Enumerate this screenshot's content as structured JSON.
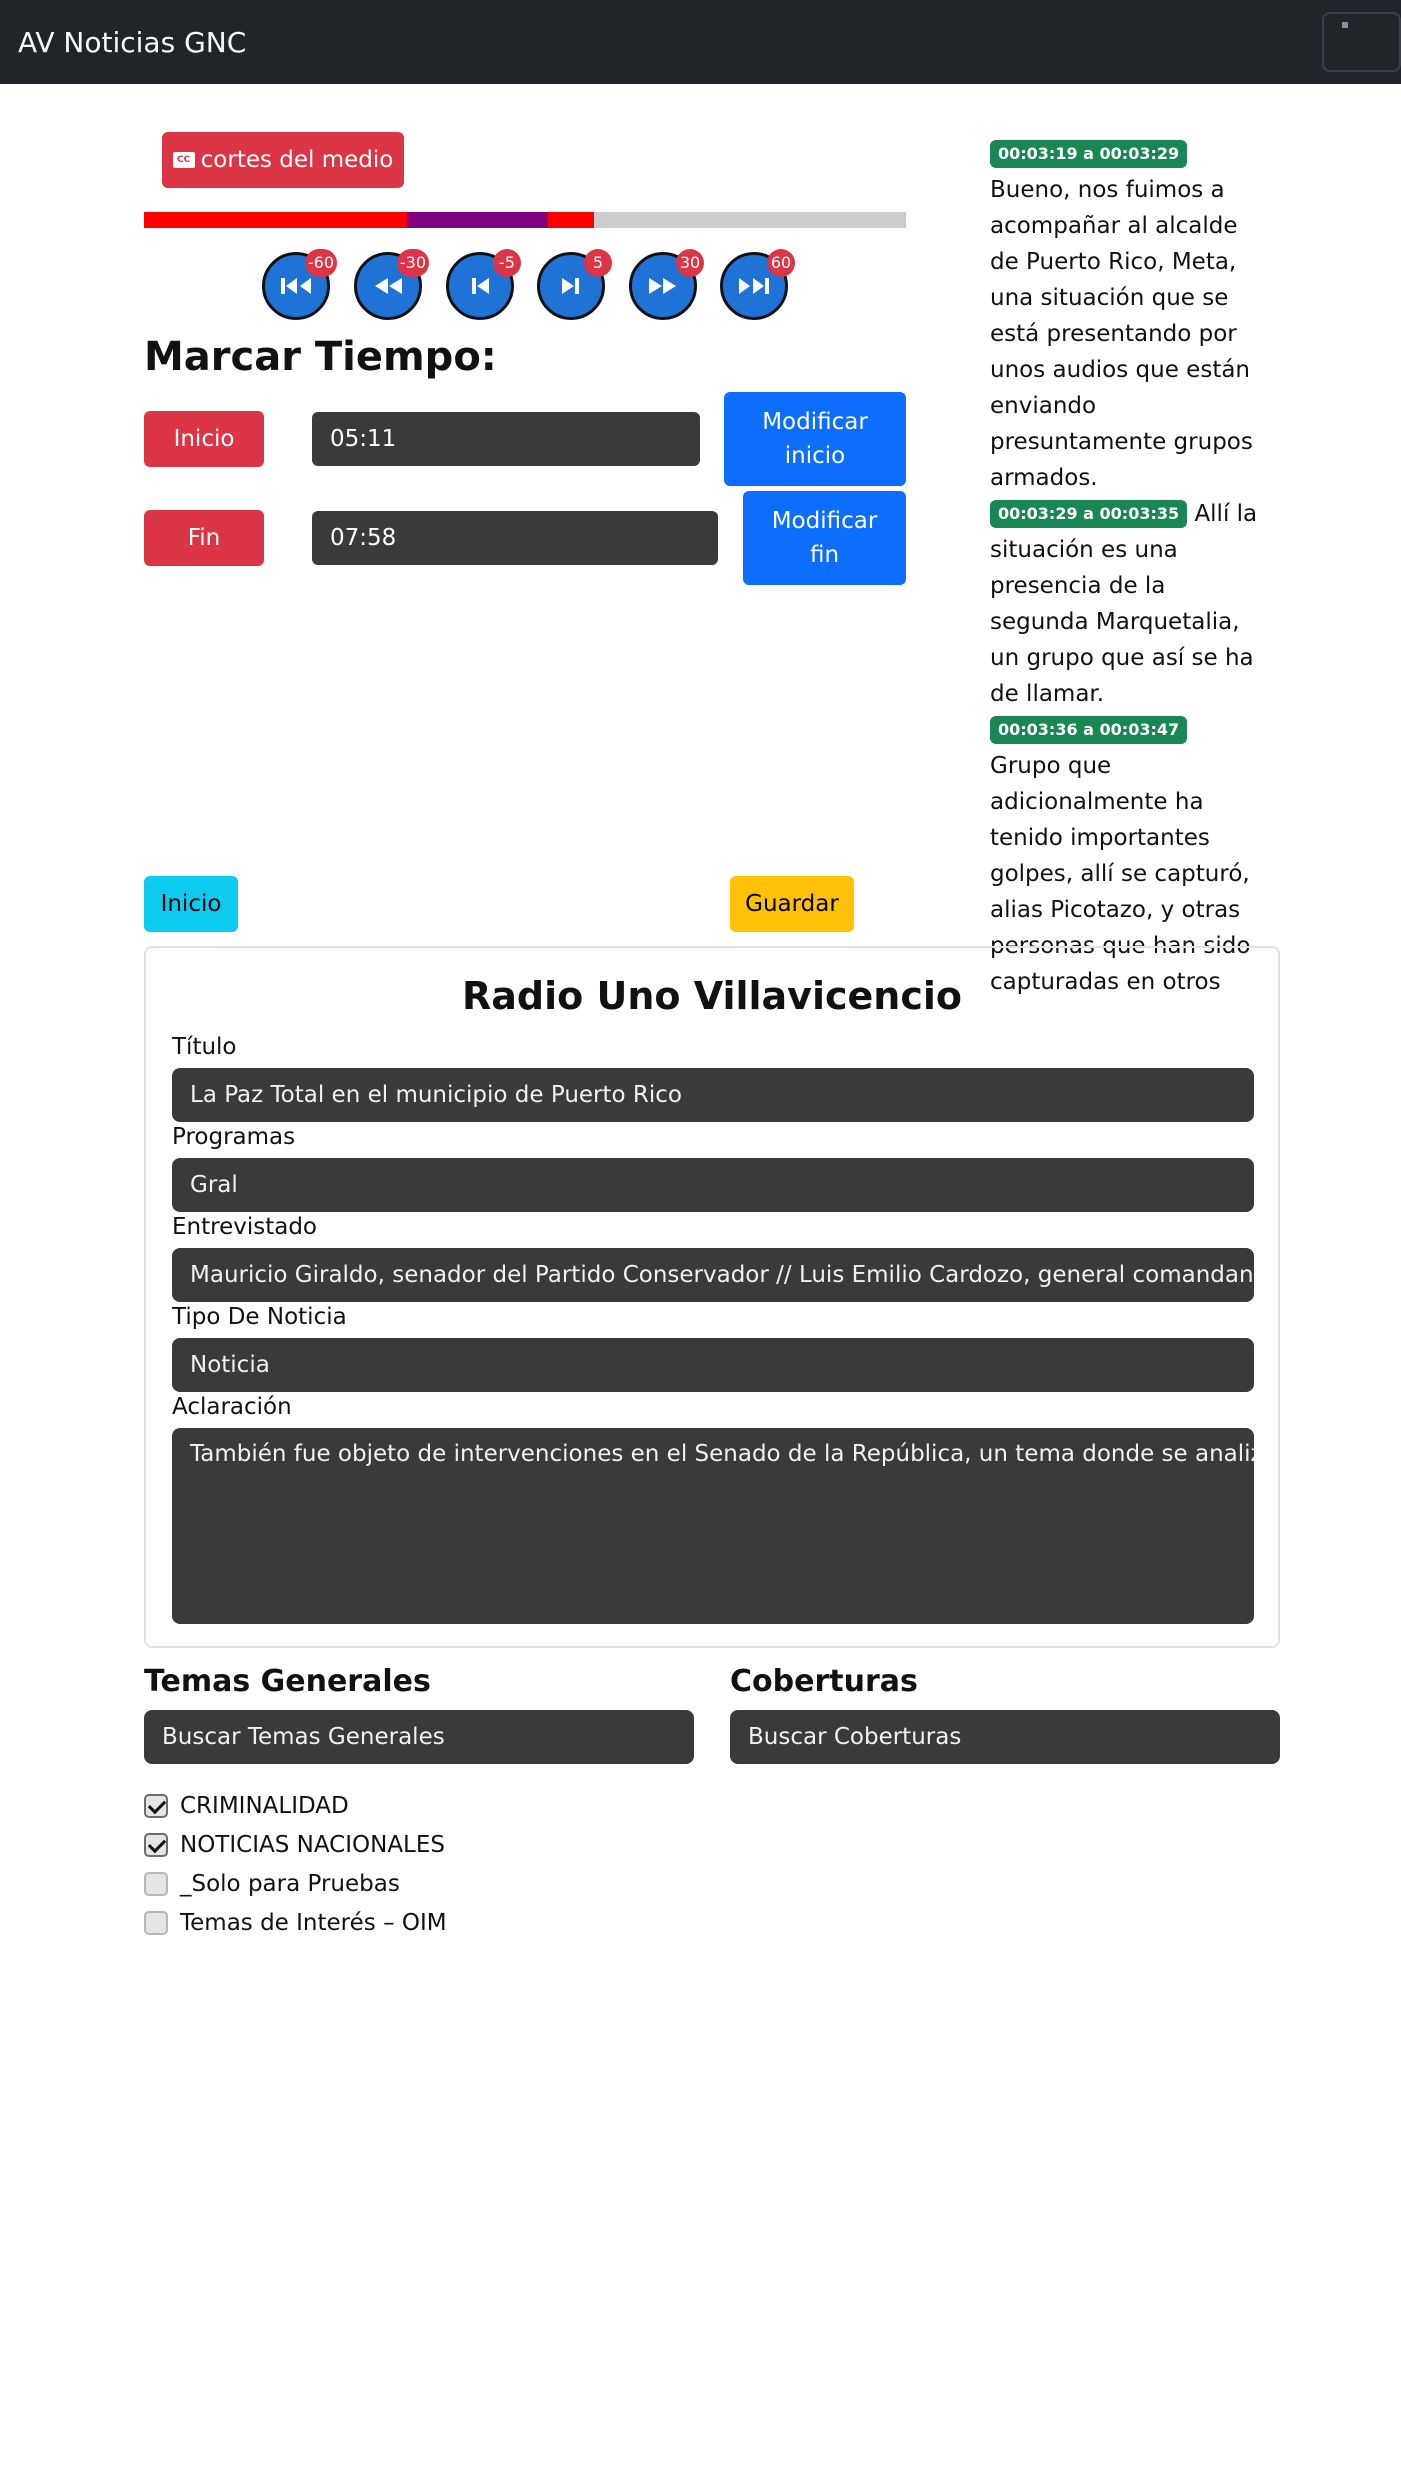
{
  "app": {
    "title": "AV Noticias GNC"
  },
  "media": {
    "cortes_label": "cortes del medio",
    "progress_segments": [
      {
        "name": "red",
        "from": 0.0,
        "to": 0.345,
        "color": "#ff0000"
      },
      {
        "name": "purple",
        "from": 0.345,
        "to": 0.53,
        "color": "#800080"
      },
      {
        "name": "red",
        "from": 0.53,
        "to": 0.59,
        "color": "#ff0000"
      }
    ],
    "controls": [
      {
        "name": "rewind-60",
        "badge": "-60",
        "icon": "skip-back-icon"
      },
      {
        "name": "rewind-30",
        "badge": "-30",
        "icon": "rewind-icon"
      },
      {
        "name": "rewind-5",
        "badge": "-5",
        "icon": "step-back-icon"
      },
      {
        "name": "forward-5",
        "badge": "5",
        "icon": "step-forward-icon"
      },
      {
        "name": "forward-30",
        "badge": "30",
        "icon": "fast-forward-icon"
      },
      {
        "name": "forward-60",
        "badge": "60",
        "icon": "skip-forward-icon"
      }
    ]
  },
  "marcar": {
    "title": "Marcar Tiempo:",
    "inicio_label": "Inicio",
    "inicio_value": "05:11",
    "modificar_inicio": "Modificar inicio",
    "fin_label": "Fin",
    "fin_value": "07:58",
    "modificar_fin": "Modificar fin"
  },
  "transcript": [
    {
      "time": "00:03:19 a 00:03:29",
      "text": "Bueno, nos fuimos a acompañar al alcalde de Puerto Rico, Meta, una situación que se está presentando por unos audios que están enviando presuntamente grupos armados."
    },
    {
      "time": "00:03:29 a 00:03:35",
      "text": "Allí la situación es una presencia de la segunda Marquetalia, un grupo que así se ha de llamar."
    },
    {
      "time": "00:03:36 a 00:03:47",
      "text": "Grupo que adicionalmente ha tenido importantes golpes, allí se capturó, alias Picotazo, y otras personas que han sido capturadas en otros"
    }
  ],
  "actions": {
    "inicio": "Inicio",
    "guardar": "Guardar"
  },
  "form": {
    "medio": "Radio Uno Villavicencio",
    "titulo_label": "Título",
    "titulo_value": "La Paz Total en el municipio de Puerto Rico",
    "programas_label": "Programas",
    "programas_value": "Gral",
    "entrevistado_label": "Entrevistado",
    "entrevistado_value": "Mauricio Giraldo, senador del Partido Conservador // Luis Emilio Cardozo, general comandante del Ejército",
    "tipo_label": "Tipo De Noticia",
    "tipo_value": "Noticia",
    "aclaracion_label": "Aclaración",
    "aclaracion_value": "También fue objeto de intervenciones en el Senado de la República, un tema donde se analizó esta situación"
  },
  "temas": {
    "title": "Temas Generales",
    "search_placeholder": "Buscar Temas Generales",
    "items": [
      {
        "label": "CRIMINALIDAD",
        "checked": true
      },
      {
        "label": "NOTICIAS NACIONALES",
        "checked": true
      },
      {
        "label": "_Solo para Pruebas",
        "checked": false
      },
      {
        "label": "Temas de Interés – OIM",
        "checked": false
      }
    ]
  },
  "coberturas": {
    "title": "Coberturas",
    "search_placeholder": "Buscar Coberturas"
  }
}
